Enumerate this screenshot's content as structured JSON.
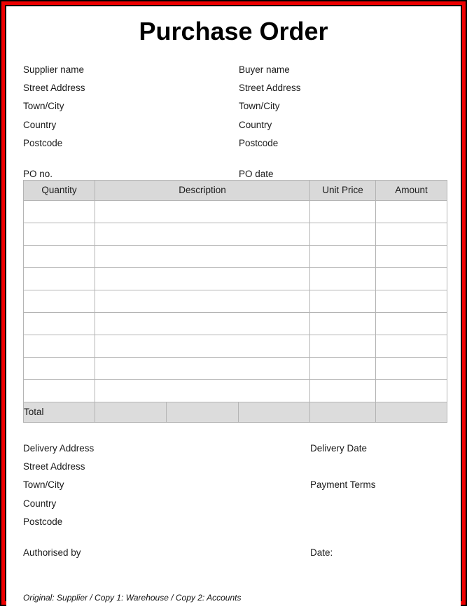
{
  "document": {
    "title": "Purchase Order"
  },
  "supplier": {
    "lines": [
      "Supplier name",
      "Street Address",
      "Town/City",
      "Country",
      "Postcode"
    ],
    "po_number_label": "PO no."
  },
  "buyer": {
    "lines": [
      "Buyer name",
      "Street Address",
      "Town/City",
      "Country",
      "Postcode"
    ],
    "po_date_label": "PO date"
  },
  "items_table": {
    "headers": [
      "Quantity",
      "Description",
      "Unit Price",
      "Amount"
    ],
    "body_row_count": 9,
    "rows": [
      {
        "quantity": "",
        "description": "",
        "unit_price": "",
        "amount": ""
      },
      {
        "quantity": "",
        "description": "",
        "unit_price": "",
        "amount": ""
      },
      {
        "quantity": "",
        "description": "",
        "unit_price": "",
        "amount": ""
      },
      {
        "quantity": "",
        "description": "",
        "unit_price": "",
        "amount": ""
      },
      {
        "quantity": "",
        "description": "",
        "unit_price": "",
        "amount": ""
      },
      {
        "quantity": "",
        "description": "",
        "unit_price": "",
        "amount": ""
      },
      {
        "quantity": "",
        "description": "",
        "unit_price": "",
        "amount": ""
      },
      {
        "quantity": "",
        "description": "",
        "unit_price": "",
        "amount": ""
      },
      {
        "quantity": "",
        "description": "",
        "unit_price": "",
        "amount": ""
      }
    ],
    "total": {
      "label": "Total",
      "sub_cell_1": "",
      "sub_cell_2": "",
      "sub_cell_3": "",
      "unit_price": "",
      "amount": ""
    }
  },
  "delivery": {
    "lines": [
      "Delivery Address",
      "Street Address",
      "Town/City",
      "Country",
      "Postcode"
    ],
    "authorised_by_label": "Authorised by"
  },
  "terms": {
    "delivery_date_label": "Delivery Date",
    "payment_terms_label": "Payment Terms",
    "date_label": "Date:"
  },
  "footer": {
    "distribution_note": "Original: Supplier / Copy 1: Warehouse / Copy 2: Accounts"
  },
  "colors": {
    "frame_red": "#ee0000",
    "frame_black": "#000000",
    "header_fill": "#d9d9d9",
    "total_fill": "#dcdcdc",
    "grid_line": "#b4b4b4"
  }
}
